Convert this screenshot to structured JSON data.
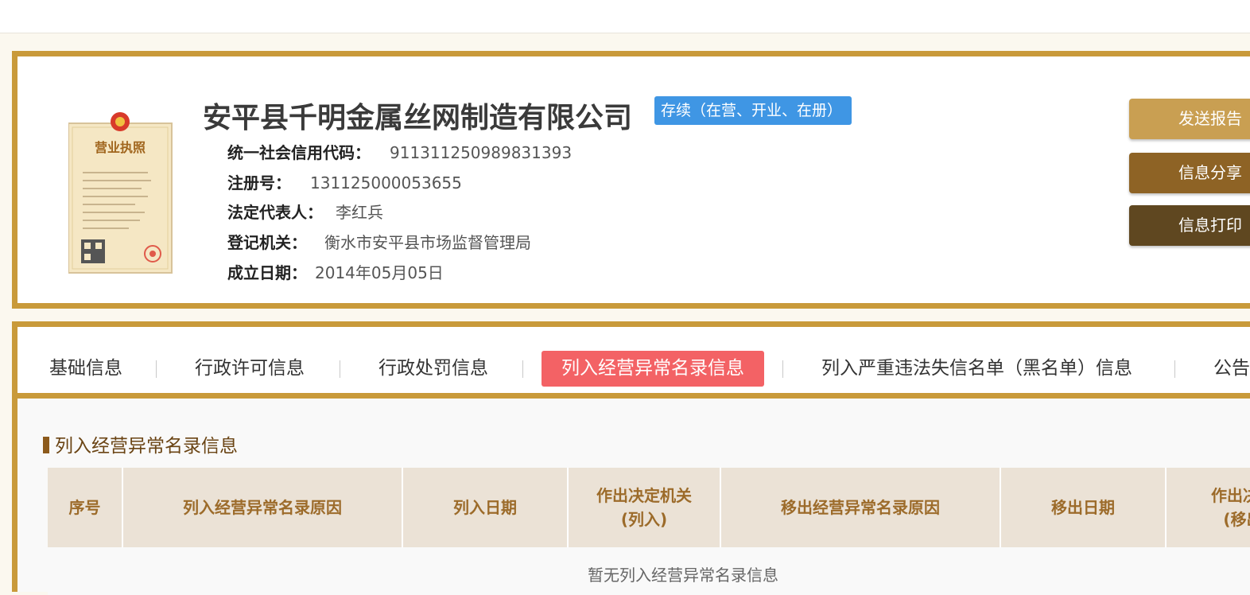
{
  "company": {
    "name": "安平县千明金属丝网制造有限公司",
    "status": "存续（在营、开业、在册）",
    "license_text": "营业执照"
  },
  "info": [
    {
      "label": "统一社会信用代码：",
      "value": "911311250989831393"
    },
    {
      "label": "注册号：",
      "value": "131125000053655"
    },
    {
      "label": "法定代表人：",
      "value": "李红兵"
    },
    {
      "label": "登记机关：",
      "value": "衡水市安平县市场监督管理局"
    },
    {
      "label": "成立日期：",
      "value": "2014年05月05日"
    }
  ],
  "actions": {
    "send_report": "发送报告",
    "share": "信息分享",
    "print": "信息打印"
  },
  "tabs": [
    {
      "label": "基础信息"
    },
    {
      "label": "行政许可信息"
    },
    {
      "label": "行政处罚信息"
    },
    {
      "label": "列入经营异常名录信息"
    },
    {
      "label": "列入严重违法失信名单（黑名单）信息"
    },
    {
      "label": "公告"
    }
  ],
  "active_tab_index": 3,
  "section": {
    "title": "列入经营异常名录信息",
    "columns": [
      "序号",
      "列入经营异常名录原因",
      "列入日期",
      "作出决定机关\n(列入)",
      "移出经营异常名录原因",
      "移出日期",
      "作出决定\n(移出"
    ],
    "empty_text": "暂无列入经营异常名录信息"
  },
  "colors": {
    "gold_border": "#c99a3a",
    "status_blue": "#3f96e4",
    "active_tab": "#f36265",
    "btn_send": "#c99f52",
    "btn_share": "#8e6325",
    "btn_print": "#5f4720"
  }
}
